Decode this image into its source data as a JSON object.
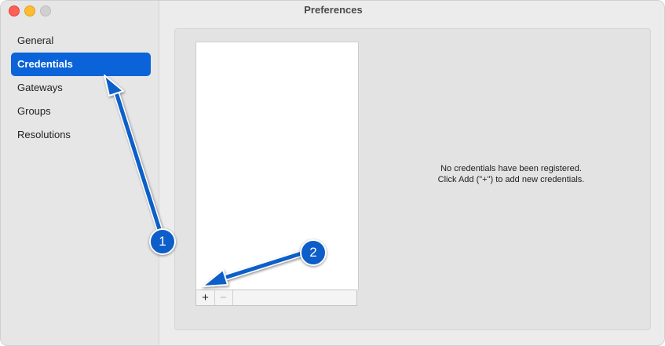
{
  "window": {
    "title": "Preferences"
  },
  "sidebar": {
    "items": [
      {
        "label": "General",
        "selected": false
      },
      {
        "label": "Credentials",
        "selected": true
      },
      {
        "label": "Gateways",
        "selected": false
      },
      {
        "label": "Groups",
        "selected": false
      },
      {
        "label": "Resolutions",
        "selected": false
      }
    ]
  },
  "credentials": {
    "toolbar": {
      "add_label": "+",
      "remove_label": "−"
    },
    "empty_message_line1": "No credentials have been registered.",
    "empty_message_line2": "Click Add (\"+\") to add new credentials."
  },
  "annotations": {
    "badge1": "1",
    "badge2": "2",
    "color": "#0d5ec9"
  },
  "colors": {
    "accent": "#0a63d8",
    "close": "#fe5f57",
    "minimize": "#febc2e",
    "zoom_disabled": "#d0d0d0"
  }
}
